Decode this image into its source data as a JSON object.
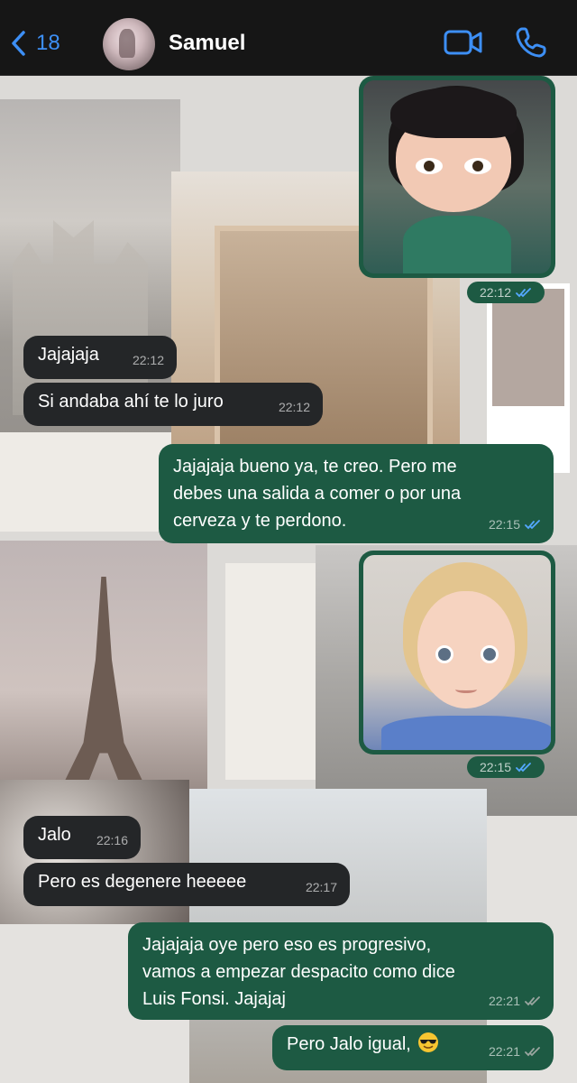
{
  "header": {
    "back_count": "18",
    "contact_name": "Samuel"
  },
  "colors": {
    "header_bg": "#161616",
    "accent": "#3d8ff5",
    "incoming_bubble": "#242628",
    "outgoing_bubble": "#1d5a43",
    "read_ticks": "#54a8ff"
  },
  "messages": [
    {
      "direction": "out",
      "type": "image",
      "image": "cartoon-girl-sticker",
      "time": "22:12",
      "status": "read"
    },
    {
      "direction": "in",
      "type": "text",
      "text": "Jajajaja",
      "time": "22:12"
    },
    {
      "direction": "in",
      "type": "text",
      "text": "Si andaba ahí te lo juro",
      "time": "22:12"
    },
    {
      "direction": "out",
      "type": "text",
      "text": "Jajajaja bueno ya, te creo. Pero me\ndebes una salida a comer o por una\ncerveza y te perdono.",
      "time": "22:15",
      "status": "read"
    },
    {
      "direction": "out",
      "type": "image",
      "image": "toddler-photo",
      "time": "22:15",
      "status": "read"
    },
    {
      "direction": "in",
      "type": "text",
      "text": "Jalo",
      "time": "22:16"
    },
    {
      "direction": "in",
      "type": "text",
      "text": "Pero es degenere heeeee",
      "time": "22:17"
    },
    {
      "direction": "out",
      "type": "text",
      "text": "Jajajaja oye pero eso es progresivo,\nvamos a empezar despacito como dice\nLuis Fonsi. Jajajaj",
      "time": "22:21",
      "status": "delivered"
    },
    {
      "direction": "out",
      "type": "text",
      "text": "Pero Jalo igual,",
      "emoji": "sunglasses-emoji",
      "time": "22:21",
      "status": "delivered"
    }
  ]
}
